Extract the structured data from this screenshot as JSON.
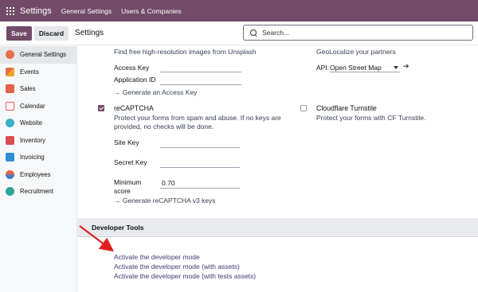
{
  "navbar": {
    "title": "Settings",
    "links": [
      "General Settings",
      "Users & Companies"
    ]
  },
  "control": {
    "save": "Save",
    "discard": "Discard",
    "title": "Settings",
    "search_placeholder": "Search..."
  },
  "sidebar": {
    "items": [
      {
        "label": "General Settings",
        "color": "#e46f4a"
      },
      {
        "label": "Events",
        "color": "#e46f4a"
      },
      {
        "label": "Sales",
        "color": "#e4604a"
      },
      {
        "label": "Calendar",
        "color": "#e4584a"
      },
      {
        "label": "Website",
        "color": "#3ab0c7"
      },
      {
        "label": "Inventory",
        "color": "#d94f4f"
      },
      {
        "label": "Invoicing",
        "color": "#2d8fd5"
      },
      {
        "label": "Employees",
        "color": "#e4604a"
      },
      {
        "label": "Recruitment",
        "color": "#2ea39a"
      }
    ]
  },
  "unsplash": {
    "description": "Find free high-resolution images from Unsplash",
    "access_key_label": "Access Key",
    "app_id_label": "Application ID",
    "generate_link": "→ Generate an Access Key"
  },
  "geo": {
    "description": "GeoLocalize your partners",
    "api_label": "API:",
    "api_value": "Open Street Map"
  },
  "recaptcha": {
    "title": "reCAPTCHA",
    "desc_line1": "Protect your forms from spam and abuse. If no keys are",
    "desc_line2": "provided, no checks will be done.",
    "site_key_label": "Site Key",
    "secret_key_label": "Secret Key",
    "min_score_label_1": "Minimum",
    "min_score_label_2": "score",
    "min_score_value": "0.70",
    "generate_link": "→ Generate reCAPTCHA v3 keys",
    "checked": true
  },
  "turnstile": {
    "title": "Cloudflare Turnstile",
    "description": "Protect your forms with CF Turnstile.",
    "checked": false
  },
  "developer_tools": {
    "title": "Developer Tools",
    "links": [
      "Activate the developer mode",
      "Activate the developer mode (with assets)",
      "Activate the developer mode (with tests assets)"
    ]
  },
  "colors": {
    "brand": "#714b67",
    "annotation_arrow": "#e02020"
  }
}
